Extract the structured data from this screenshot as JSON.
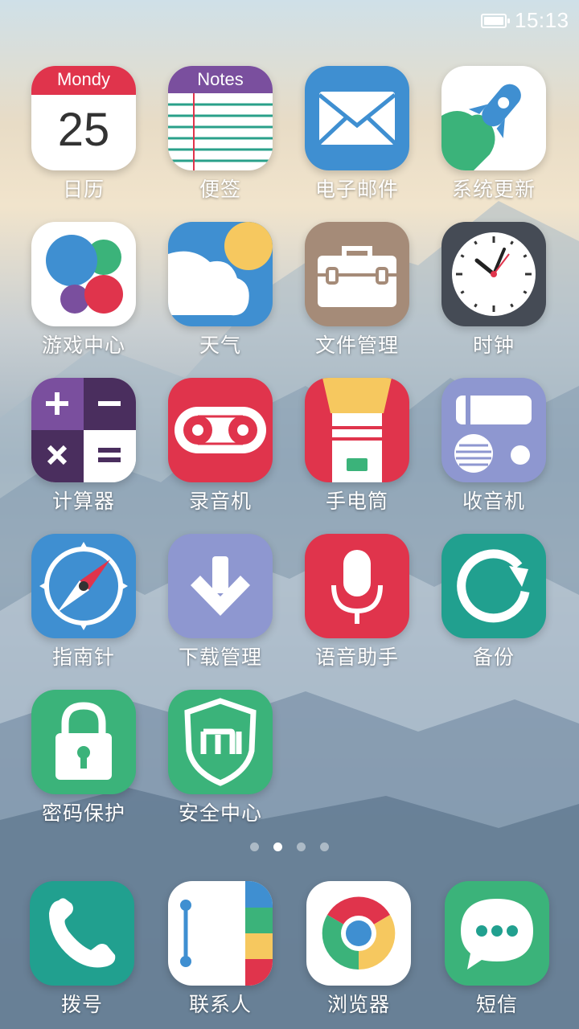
{
  "status_bar": {
    "time": "15:13",
    "battery_icon": "battery-icon"
  },
  "calendar": {
    "month": "Mondy",
    "day": "25"
  },
  "notes_header": "Notes",
  "apps": [
    {
      "label": "日历"
    },
    {
      "label": "便签"
    },
    {
      "label": "电子邮件"
    },
    {
      "label": "系统更新"
    },
    {
      "label": "游戏中心"
    },
    {
      "label": "天气"
    },
    {
      "label": "文件管理"
    },
    {
      "label": "时钟"
    },
    {
      "label": "计算器"
    },
    {
      "label": "录音机"
    },
    {
      "label": "手电筒"
    },
    {
      "label": "收音机"
    },
    {
      "label": "指南针"
    },
    {
      "label": "下载管理"
    },
    {
      "label": "语音助手"
    },
    {
      "label": "备份"
    },
    {
      "label": "密码保护"
    },
    {
      "label": "安全中心"
    }
  ],
  "dock": [
    {
      "label": "拨号"
    },
    {
      "label": "联系人"
    },
    {
      "label": "浏览器"
    },
    {
      "label": "短信"
    }
  ],
  "page_indicator": {
    "count": 4,
    "active_index": 1
  },
  "colors": {
    "red": "#e0344c",
    "purple": "#7a4f9e",
    "blue": "#3f8fd1",
    "green": "#3bb37a",
    "teal": "#21a08f",
    "taupe": "#a58b78",
    "dark": "#454b55",
    "lavender": "#8e97d0",
    "yellow": "#f6c85f"
  }
}
